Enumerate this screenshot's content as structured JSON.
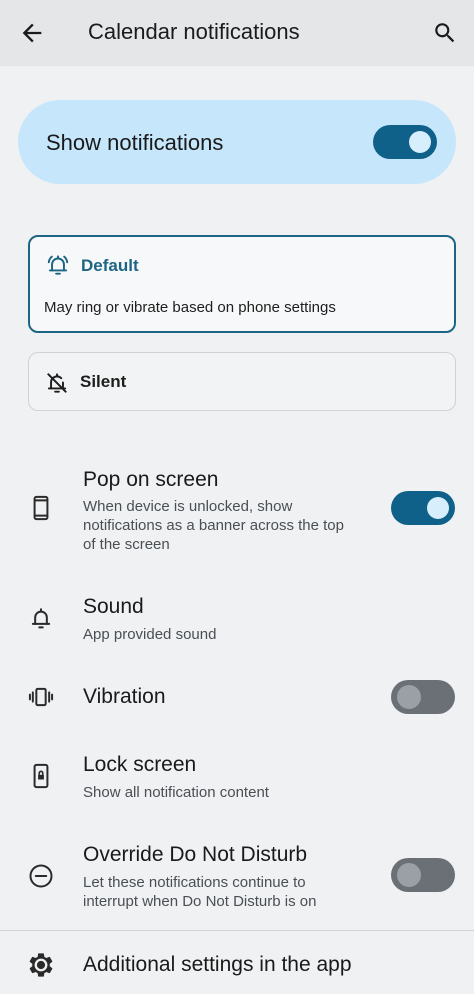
{
  "appbar": {
    "title": "Calendar notifications",
    "back_icon": "arrow-back-icon",
    "search_icon": "search-icon"
  },
  "master": {
    "label": "Show notifications",
    "enabled": true
  },
  "modes": {
    "default": {
      "name": "Default",
      "description": "May ring or vibrate based on phone settings",
      "icon": "bell-ringing-icon",
      "selected": true
    },
    "silent": {
      "name": "Silent",
      "icon": "bell-off-icon",
      "selected": false
    }
  },
  "settings": {
    "pop_on_screen": {
      "title": "Pop on screen",
      "line1": "When device is unlocked, show",
      "line2": "notifications as a banner across the top",
      "line3": "of the screen",
      "icon": "phone-icon",
      "enabled": true
    },
    "sound": {
      "title": "Sound",
      "subtitle": "App provided sound",
      "icon": "bell-icon"
    },
    "vibration": {
      "title": "Vibration",
      "icon": "vibration-icon",
      "enabled": false
    },
    "lock_screen": {
      "title": "Lock screen",
      "subtitle": "Show all notification content",
      "icon": "lock-screen-icon"
    },
    "dnd": {
      "title": "Override Do Not Disturb",
      "line1": "Let these notifications continue to",
      "line2": "interrupt when Do Not Disturb is on",
      "icon": "do-not-disturb-icon",
      "enabled": false
    },
    "additional": {
      "title": "Additional settings in the app",
      "icon": "gear-icon"
    }
  },
  "colors": {
    "accent": "#0f6189",
    "master_bg": "#c6e6fb",
    "page_bg": "#eff1f3"
  }
}
